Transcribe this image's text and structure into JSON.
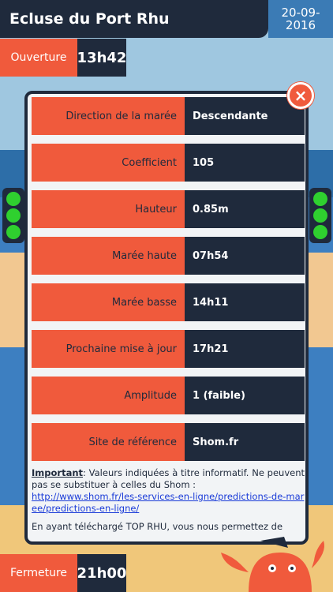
{
  "header": {
    "title": "Ecluse du Port Rhu",
    "date_line1": "20-09-",
    "date_line2": "2016"
  },
  "opening": {
    "label": "Ouverture",
    "time": "13h42"
  },
  "closing": {
    "label": "Fermeture",
    "time": "21h00"
  },
  "modal": {
    "close_glyph": "×",
    "rows": [
      {
        "key": "Direction de la marée",
        "value": "Descendante"
      },
      {
        "key": "Coefficient",
        "value": "105"
      },
      {
        "key": "Hauteur",
        "value": "0.85m"
      },
      {
        "key": "Marée haute",
        "value": "07h54"
      },
      {
        "key": "Marée basse",
        "value": "14h11"
      },
      {
        "key": "Prochaine mise à jour",
        "value": "17h21"
      },
      {
        "key": "Amplitude",
        "value": "1 (faible)"
      },
      {
        "key": "Site de référence",
        "value": "Shom.fr"
      }
    ],
    "note_important": "Important",
    "note_text": ": Valeurs indiquées à titre informatif. Ne peuvent pas se substituer à celles du Shom :",
    "note_link": "http://www.shom.fr/les-services-en-ligne/predictions-de-maree/predictions-en-ligne/",
    "note_text2": "En ayant téléchargé TOP RHU, vous nous permettez de"
  },
  "colors": {
    "navy": "#1f2a3c",
    "orange": "#f05a3c",
    "blue": "#3b7bb5",
    "light": "#2fd02f"
  }
}
